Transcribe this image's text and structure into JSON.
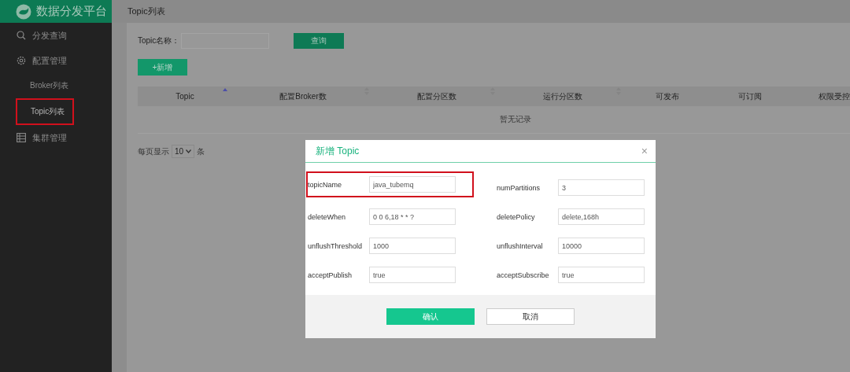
{
  "sidebar": {
    "logo_text": "数据分发平台",
    "items": [
      {
        "label": "分发查询"
      },
      {
        "label": "配置管理",
        "children": [
          {
            "label": "Broker列表",
            "selected": false,
            "highlighted": false
          },
          {
            "label": "Topic列表",
            "selected": true,
            "highlighted": true
          }
        ]
      },
      {
        "label": "集群管理"
      }
    ]
  },
  "page_title": "Topic列表",
  "search": {
    "label": "Topic名称：",
    "button": "查询"
  },
  "add_button": "+新增",
  "table": {
    "columns": [
      {
        "label": "Topic",
        "sortable": true,
        "sorted_ascending": true
      },
      {
        "label": "配置Broker数",
        "sortable": true,
        "sorted_ascending": false
      },
      {
        "label": "配置分区数",
        "sortable": true,
        "sorted_ascending": false
      },
      {
        "label": "运行分区数",
        "sortable": true,
        "sorted_ascending": false
      },
      {
        "label": "可发布"
      },
      {
        "label": "可订阅"
      },
      {
        "label": "权限受控"
      }
    ],
    "empty_text": "暂无记录"
  },
  "pagination": {
    "prefix": "每页显示",
    "page_size": "10",
    "suffix": "条"
  },
  "dialog": {
    "title": "新增 Topic",
    "close": "×",
    "fields": [
      {
        "label": "topicName",
        "value": "java_tubemq",
        "highlighted": true
      },
      {
        "label": "numPartitions",
        "value": "3",
        "highlighted": false
      },
      {
        "label": "deleteWhen",
        "value": "0 0 6,18 * * ?",
        "highlighted": false
      },
      {
        "label": "deletePolicy",
        "value": "delete,168h",
        "highlighted": false
      },
      {
        "label": "unflushThreshold",
        "value": "1000",
        "highlighted": false
      },
      {
        "label": "unflushInterval",
        "value": "10000",
        "highlighted": false
      },
      {
        "label": "acceptPublish",
        "value": "true",
        "highlighted": false
      },
      {
        "label": "acceptSubscribe",
        "value": "true",
        "highlighted": false
      }
    ],
    "confirm": "确认",
    "cancel": "取消"
  }
}
